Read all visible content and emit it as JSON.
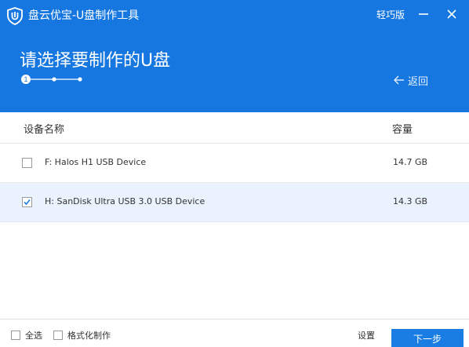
{
  "window": {
    "title": "盘云优宝-U盘制作工具",
    "edition": "轻巧版"
  },
  "header": {
    "page_title": "请选择要制作的U盘",
    "step_current": "1",
    "back_label": "返回"
  },
  "table": {
    "columns": [
      "设备名称",
      "容量"
    ],
    "rows": [
      {
        "name": "F: Halos H1 USB Device",
        "size": "14.7 GB",
        "checked": false
      },
      {
        "name": "H: SanDisk Ultra USB 3.0 USB Device",
        "size": "14.3 GB",
        "checked": true
      }
    ]
  },
  "footer": {
    "select_all_label": "全选",
    "format_label": "格式化制作",
    "settings_label": "设置",
    "next_label": "下一步"
  },
  "colors": {
    "header_bg": "#1677e0",
    "accent": "#1a7de3",
    "selected_row": "#eaf2fd"
  }
}
